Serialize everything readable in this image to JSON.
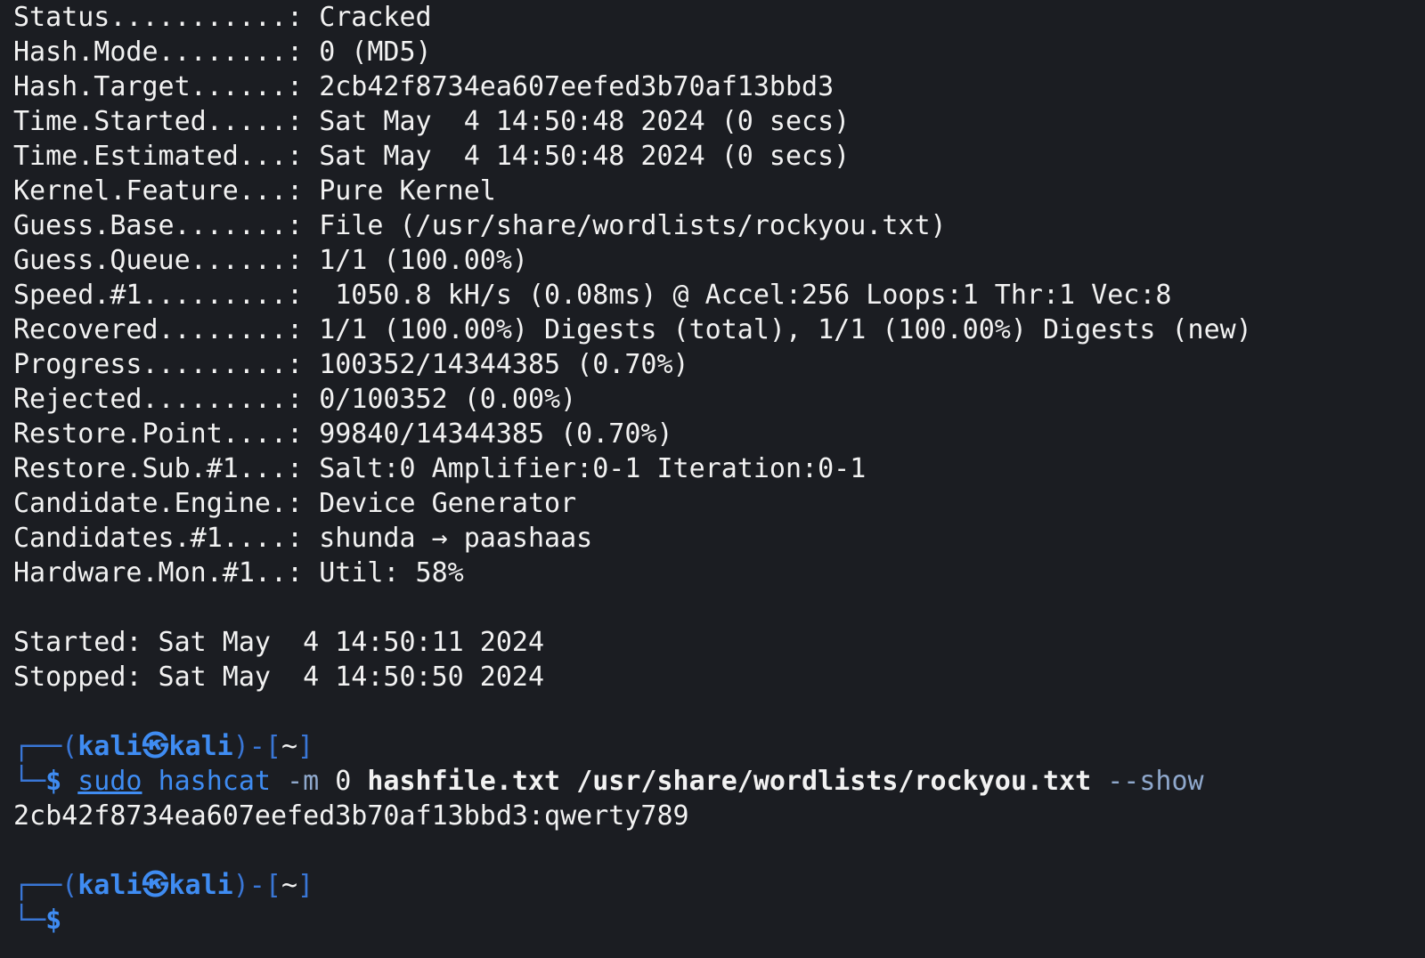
{
  "terminal": {
    "stats": [
      {
        "key": "Status",
        "dots": "...........",
        "value": "Cracked"
      },
      {
        "key": "Hash.Mode",
        "dots": "........",
        "value": "0 (MD5)"
      },
      {
        "key": "Hash.Target",
        "dots": "......",
        "value": "2cb42f8734ea607eefed3b70af13bbd3"
      },
      {
        "key": "Time.Started",
        "dots": ".....",
        "value": "Sat May  4 14:50:48 2024 (0 secs)"
      },
      {
        "key": "Time.Estimated",
        "dots": "...",
        "value": "Sat May  4 14:50:48 2024 (0 secs)"
      },
      {
        "key": "Kernel.Feature",
        "dots": "...",
        "value": "Pure Kernel"
      },
      {
        "key": "Guess.Base",
        "dots": ".......",
        "value": "File (/usr/share/wordlists/rockyou.txt)"
      },
      {
        "key": "Guess.Queue",
        "dots": "......",
        "value": "1/1 (100.00%)"
      },
      {
        "key": "Speed.#1",
        "dots": ".........",
        "value": " 1050.8 kH/s (0.08ms) @ Accel:256 Loops:1 Thr:1 Vec:8"
      },
      {
        "key": "Recovered",
        "dots": "........",
        "value": "1/1 (100.00%) Digests (total), 1/1 (100.00%) Digests (new)"
      },
      {
        "key": "Progress",
        "dots": ".........",
        "value": "100352/14344385 (0.70%)"
      },
      {
        "key": "Rejected",
        "dots": ".........",
        "value": "0/100352 (0.00%)"
      },
      {
        "key": "Restore.Point",
        "dots": "....",
        "value": "99840/14344385 (0.70%)"
      },
      {
        "key": "Restore.Sub.#1",
        "dots": "...",
        "value": "Salt:0 Amplifier:0-1 Iteration:0-1"
      },
      {
        "key": "Candidate.Engine",
        "dots": ".",
        "value": "Device Generator"
      },
      {
        "key": "Candidates.#1",
        "dots": "....",
        "value": "shunda → paashaas"
      },
      {
        "key": "Hardware.Mon.#1",
        "dots": "..",
        "value": "Util: 58%"
      }
    ],
    "started": "Started: Sat May  4 14:50:11 2024",
    "stopped": "Stopped: Sat May  4 14:50:50 2024",
    "prompt": {
      "box_top": "┌──(",
      "user": "kali",
      "skull": "㉿",
      "host": "kali",
      "close": ")-[",
      "dir": "~",
      "end": "]",
      "box_bot": "└─",
      "dollar": "$"
    },
    "command": {
      "sudo": "sudo",
      "name": "hashcat",
      "flag_m": "-m",
      "mode": "0",
      "hashfile": "hashfile.txt",
      "wordlist": "/usr/share/wordlists/rockyou.txt",
      "flag_show": "--show"
    },
    "result": "2cb42f8734ea607eefed3b70af13bbd3:qwerty789"
  },
  "colors": {
    "background": "#1b1d22",
    "prompt_blue": "#3f8cf2",
    "text": "#f2f2f2"
  }
}
